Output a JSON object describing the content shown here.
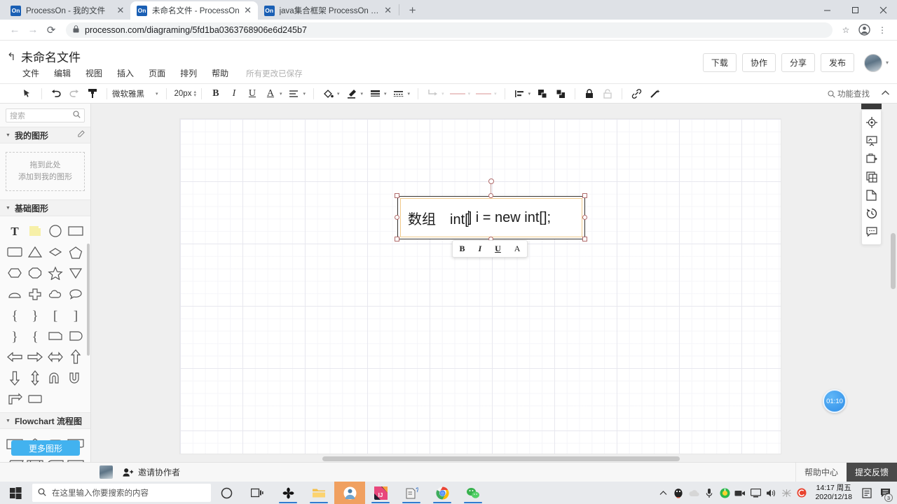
{
  "browser": {
    "tabs": [
      {
        "favicon": "On",
        "title": "ProcessOn - 我的文件",
        "active": false
      },
      {
        "favicon": "On",
        "title": "未命名文件 - ProcessOn",
        "active": true
      },
      {
        "favicon": "On",
        "title": "java集合框架 ProcessOn Mind",
        "active": false
      }
    ],
    "new_tab_label": "+",
    "close_label": "✕",
    "window_controls": {
      "minimize": "─",
      "maximize": "❐",
      "close": "✕"
    },
    "nav": {
      "back": "←",
      "forward": "→",
      "reload": "⟳"
    },
    "address": {
      "lock_icon": "lock-icon",
      "url": "processon.com/diagraming/5fd1ba0363768906e6d245b7"
    },
    "toolbar_right": {
      "bookmark": "☆",
      "profile": "profile-icon",
      "menu": "⋮"
    }
  },
  "app_header": {
    "back_arrow": "↰",
    "title": "未命名文件",
    "menus": [
      "文件",
      "编辑",
      "视图",
      "插入",
      "页面",
      "排列",
      "帮助"
    ],
    "save_status": "所有更改已保存",
    "actions": [
      "下载",
      "协作",
      "分享",
      "发布"
    ],
    "avatar_caret": "▾"
  },
  "format_toolbar": {
    "pointer_icon": "pointer-format-painter-icon",
    "undo": "↶",
    "redo": "↷",
    "painter": "format-painter-icon",
    "font_name": "微软雅黑",
    "font_size": "20px",
    "bold": "B",
    "italic": "I",
    "underline": "U",
    "font_color": "A",
    "align": "≡",
    "fill": "fill-bucket-icon",
    "line_color": "pen-icon",
    "line_weight": "line-weight-icon",
    "line_style": "line-style-icon",
    "connector": "connector-icon",
    "line_start": "line-start-icon",
    "line_end": "line-end-icon",
    "list": "list-icon",
    "front": "bring-front-icon",
    "back": "send-back-icon",
    "lock": "lock-icon",
    "unlock": "unlock-icon",
    "link": "link-icon",
    "magic": "magic-wand-icon",
    "caret": "▾",
    "search_label": "功能查找",
    "search_icon": "search-icon",
    "collapse_icon": "⌃"
  },
  "left_panel": {
    "search_placeholder": "搜索",
    "search_icon": "search-icon",
    "sections": [
      {
        "title": "我的图形",
        "edit_icon": "edit-icon"
      },
      {
        "title": "基础图形"
      },
      {
        "title": "Flowchart 流程图"
      }
    ],
    "dropzone_line1": "拖到此处",
    "dropzone_line2": "添加到我的图形",
    "more_shapes": "更多图形",
    "basic_shapes": [
      "text-T-icon",
      "sticky-note-icon",
      "circle-icon",
      "rectangle-icon",
      "rounded-rect-icon",
      "triangle-icon",
      "diamond-icon",
      "pentagon-icon",
      "hexagon-icon",
      "octagon-icon",
      "star-icon",
      "inverted-triangle-icon",
      "trapezoid-icon",
      "cross-icon",
      "cloud-icon",
      "speech-bubble-icon",
      "brace-left-icon",
      "brace-right-icon",
      "bracket-left-icon",
      "bracket-right-icon",
      "curly-right-icon",
      "curly-left-icon",
      "card-icon",
      "drop-icon",
      "arrow-left-icon",
      "arrow-right-icon",
      "arrow-double-icon",
      "arrow-up-icon",
      "arrow-down-icon",
      "arrow-updown-icon",
      "u-turn-icon",
      "u-shape-icon",
      "corner-arrow-icon",
      "rect2-icon"
    ],
    "flowchart_shapes": [
      "process-icon",
      "decision-icon",
      "terminator-icon",
      "document-icon",
      "data-icon",
      "predefined-process-icon",
      "internal-storage-icon",
      "table-icon"
    ]
  },
  "canvas": {
    "shape": {
      "text_before": "数组　int[",
      "text_after": "] i = new int[];",
      "caret": "text-caret"
    },
    "mini_format": {
      "bold": "B",
      "italic": "I",
      "underline": "U",
      "font": "A"
    },
    "timer_badge": "01:10"
  },
  "right_tools": [
    "navigator-icon",
    "presentation-icon",
    "export-image-icon",
    "layers-icon",
    "page-icon",
    "history-icon",
    "comment-icon"
  ],
  "bottom_bar": {
    "invite_icon": "add-person-icon",
    "invite_label": "邀请协作者",
    "help": "帮助中心",
    "feedback": "提交反馈"
  },
  "taskbar": {
    "start_icon": "windows-start-icon",
    "search_icon": "search-icon",
    "search_placeholder": "在这里输入你要搜索的内容",
    "cortana_icon": "cortana-circle-icon",
    "taskview_icon": "task-view-icon",
    "apps": [
      "snipaste-icon",
      "file-explorer-icon",
      "processon-app-icon",
      "intellij-idea-icon",
      "help-doc-icon",
      "chrome-icon",
      "wechat-icon"
    ],
    "tray": [
      "chevron-up-icon",
      "qq-icon",
      "onedrive-icon",
      "mic-icon",
      "360-icon",
      "camera-icon",
      "display-icon",
      "volume-icon",
      "ime-icon",
      "sogou-icon"
    ],
    "time": "14:17 周五",
    "date": "2020/12/18",
    "notes_icon": "notes-icon",
    "notification_icon": "notification-icon",
    "notification_count": "3"
  },
  "colors": {
    "accent_blue": "#42b2ef",
    "tab_active": "#ffffff",
    "tab_bar": "#dee1e6",
    "shape_border": "#33312f",
    "selection_handle": "#b06a6a",
    "text_frame": "#f0c98a",
    "feedback_bg": "#4a4a4a"
  }
}
